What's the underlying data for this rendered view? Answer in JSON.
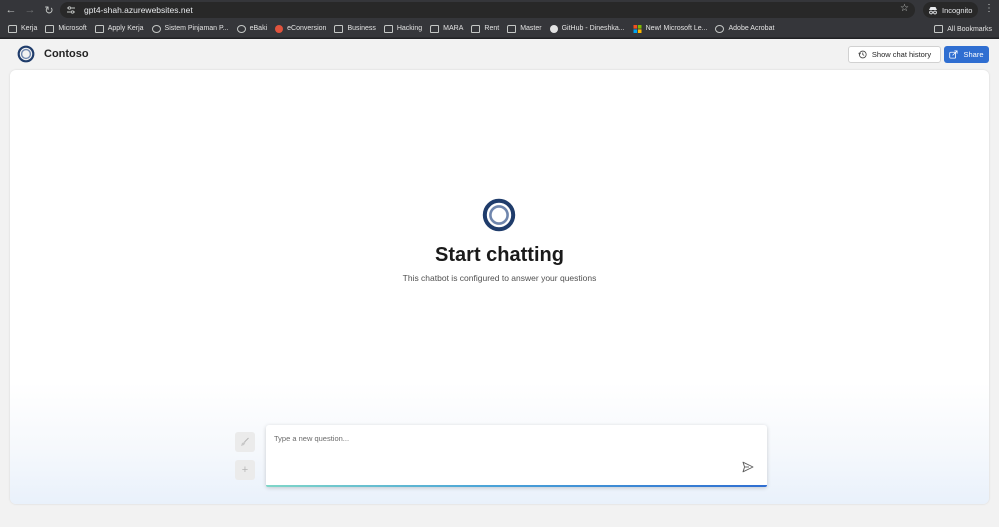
{
  "browser": {
    "url": "gpt4-shah.azurewebsites.net",
    "profile_label": "Incognito",
    "bookmarks": [
      {
        "label": "Kerja",
        "icon": "folder-icon"
      },
      {
        "label": "Microsoft",
        "icon": "folder-icon"
      },
      {
        "label": "Apply Kerja",
        "icon": "folder-icon"
      },
      {
        "label": "Sistem Pinjaman P...",
        "icon": "globe-icon"
      },
      {
        "label": "eBaki",
        "icon": "globe-icon"
      },
      {
        "label": "eConversion",
        "icon": "econversion-icon"
      },
      {
        "label": "Business",
        "icon": "folder-icon"
      },
      {
        "label": "Hacking",
        "icon": "folder-icon"
      },
      {
        "label": "MARA",
        "icon": "folder-icon"
      },
      {
        "label": "Rent",
        "icon": "folder-icon"
      },
      {
        "label": "Master",
        "icon": "folder-icon"
      },
      {
        "label": "GitHub - Dineshka...",
        "icon": "github-icon"
      },
      {
        "label": "New! Microsoft Le...",
        "icon": "microsoft-icon"
      },
      {
        "label": "Adobe Acrobat",
        "icon": "globe-icon"
      }
    ],
    "all_bookmarks_label": "All Bookmarks"
  },
  "app": {
    "brand": "Contoso",
    "show_history_label": "Show chat history",
    "share_label": "Share",
    "empty_title": "Start chatting",
    "empty_subtitle": "This chatbot is configured to answer your questions",
    "input_placeholder": "Type a new question...",
    "accent_color": "#2f6ed1"
  }
}
